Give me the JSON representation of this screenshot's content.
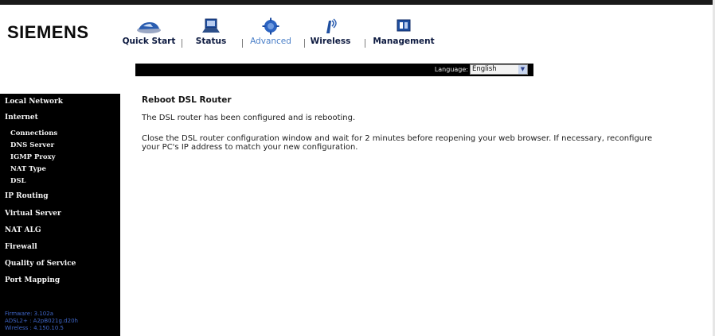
{
  "brand": {
    "name": "SIEMENS"
  },
  "nav": {
    "items": [
      {
        "label": "Quick Start",
        "icon": "car-icon"
      },
      {
        "label": "Status",
        "icon": "laptop-icon"
      },
      {
        "label": "Advanced",
        "icon": "gear-globe-icon",
        "active": true
      },
      {
        "label": "Wireless",
        "icon": "antenna-icon"
      },
      {
        "label": "Management",
        "icon": "display-icon"
      }
    ]
  },
  "language": {
    "label": "Language:",
    "selected": "English"
  },
  "sidebar": {
    "items": [
      {
        "label": "Local Network"
      },
      {
        "label": "Internet"
      },
      {
        "label": "Connections",
        "sub": true
      },
      {
        "label": "DNS Server",
        "sub": true
      },
      {
        "label": "IGMP Proxy",
        "sub": true
      },
      {
        "label": "NAT Type",
        "sub": true
      },
      {
        "label": "DSL",
        "sub": true
      },
      {
        "label": "IP Routing"
      },
      {
        "label": "Virtual Server"
      },
      {
        "label": "NAT ALG"
      },
      {
        "label": "Firewall"
      },
      {
        "label": "Quality of Service"
      },
      {
        "label": "Port Mapping"
      }
    ],
    "status": [
      "Firmware: 3.102a",
      "ADSL2+ : A2pB021g.d20h",
      "Wireless : 4.150.10.5"
    ]
  },
  "content": {
    "title": "Reboot DSL Router",
    "message": "The DSL router has been configured and is rebooting.",
    "instructions": "Close the DSL router configuration window and wait for 2 minutes before reopening your web browser. If necessary, reconfigure your PC's IP address to match your new configuration."
  },
  "colors": {
    "sidebar_bg": "#000000",
    "nav_label": "#0d1a40",
    "nav_active": "#4a7fc8",
    "status_text": "#3f66c8"
  }
}
